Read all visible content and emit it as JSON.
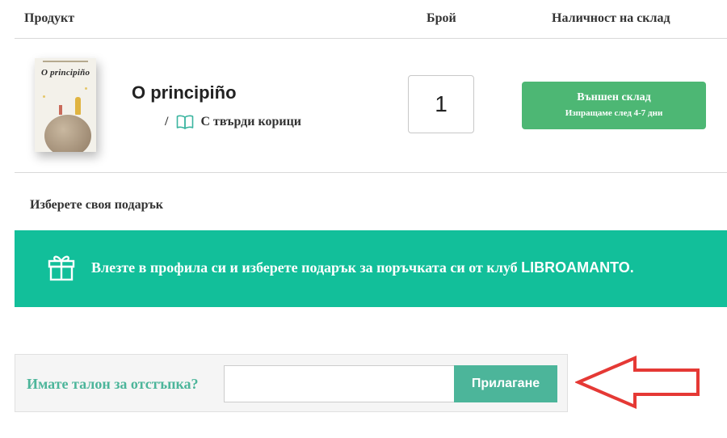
{
  "table_header": {
    "product": "Продукт",
    "quantity": "Брой",
    "availability": "Наличност на склад"
  },
  "product": {
    "cover_title": "O principiño",
    "title": "O principiño",
    "separator": "/",
    "format_icon": "book-open-icon",
    "format": "С твърди корици",
    "quantity": "1",
    "stock_status": "Външен склад",
    "stock_note": "Изпращаме след 4-7 дни"
  },
  "gift": {
    "heading": "Изберете своя подарък",
    "icon": "gift-icon",
    "text": "Влезте в профила си и изберете подарък за поръчката си от клуб",
    "brand": "LIBROAMANTO."
  },
  "coupon": {
    "label": "Имате талон за отстъпка?",
    "input_value": "",
    "apply_label": "Прилагане"
  },
  "colors": {
    "accent": "#12bf9a",
    "stock_green": "#4db774",
    "coupon_green": "#4cb59a",
    "annotation_red": "#e53935"
  }
}
